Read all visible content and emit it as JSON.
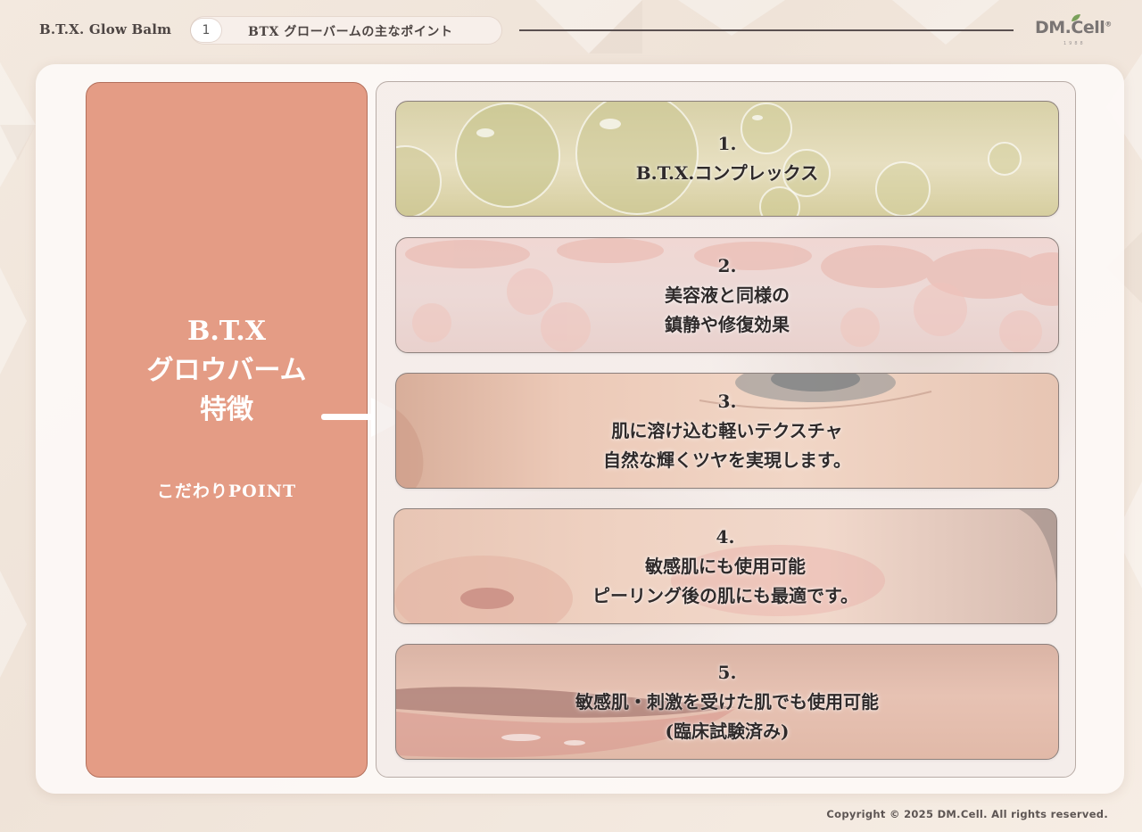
{
  "header": {
    "brand": "B.T.X. Glow Balm",
    "section_number": "1",
    "section_title": "BTX グローバームの主なポイント",
    "logo_text": "DM.Cell",
    "logo_mark": "®",
    "logo_sub": "1988"
  },
  "left_panel": {
    "title_lines": [
      "B.T.X",
      "グロウバーム",
      "特徴"
    ],
    "subtitle": "こだわりPOINT"
  },
  "points": [
    {
      "number": "1.",
      "lines": [
        "B.T.X.コンプレックス"
      ]
    },
    {
      "number": "2.",
      "lines": [
        "美容液と同様の",
        "鎮静や修復効果"
      ]
    },
    {
      "number": "3.",
      "lines": [
        "肌に溶け込む軽いテクスチャ",
        "自然な輝くツヤを実現します。"
      ]
    },
    {
      "number": "4.",
      "lines": [
        "敏感肌にも使用可能",
        "ピーリング後の肌にも最適です。"
      ]
    },
    {
      "number": "5.",
      "lines": [
        "敏感肌・刺激を受けた肌でも使用可能",
        "(臨床試験済み)"
      ]
    }
  ],
  "footer": {
    "copyright": "Copyright © 2025 DM.Cell. All rights reserved."
  },
  "colors": {
    "accent_panel": "#e49c85",
    "text_dark": "#2f2a2a",
    "background": "#f3e9df"
  }
}
